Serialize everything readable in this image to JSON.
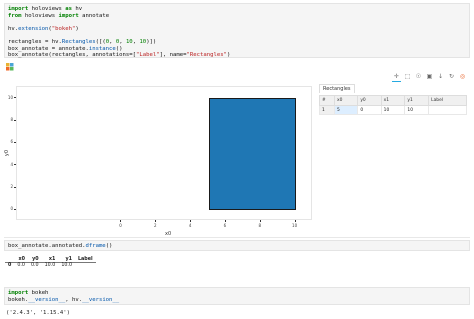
{
  "cell1": {
    "lines": [
      [
        [
          "kw",
          "import"
        ],
        [
          "plain",
          " holoviews "
        ],
        [
          "kw",
          "as"
        ],
        [
          "plain",
          " hv"
        ]
      ],
      [
        [
          "kw",
          "from"
        ],
        [
          "plain",
          " holoviews "
        ],
        [
          "kw",
          "import"
        ],
        [
          "plain",
          " annotate"
        ]
      ],
      [
        [
          "plain",
          ""
        ]
      ],
      [
        [
          "plain",
          "hv."
        ],
        [
          "fn",
          "extension"
        ],
        [
          "plain",
          "("
        ],
        [
          "str",
          "\"bokeh\""
        ],
        [
          "plain",
          ")"
        ]
      ],
      [
        [
          "plain",
          ""
        ]
      ],
      [
        [
          "plain",
          "rectangles = hv."
        ],
        [
          "fn",
          "Rectangles"
        ],
        [
          "plain",
          "([("
        ],
        [
          "num",
          "0"
        ],
        [
          "plain",
          ", "
        ],
        [
          "num",
          "0"
        ],
        [
          "plain",
          ", "
        ],
        [
          "num",
          "10"
        ],
        [
          "plain",
          ", "
        ],
        [
          "num",
          "10"
        ],
        [
          "plain",
          ")])"
        ]
      ],
      [
        [
          "plain",
          "box_annotate = annotate."
        ],
        [
          "fn",
          "instance"
        ],
        [
          "plain",
          "()"
        ]
      ],
      [
        [
          "plain",
          "box_annotate(rectangles, annotations=["
        ],
        [
          "str",
          "\"Label\""
        ],
        [
          "plain",
          "], name="
        ],
        [
          "str",
          "\"Rectangles\""
        ],
        [
          "plain",
          ")"
        ]
      ]
    ]
  },
  "plot": {
    "xlabel": "x0",
    "ylabel": "y0",
    "x_ticks": [
      "0",
      "2",
      "4",
      "6",
      "8",
      "10"
    ],
    "y_ticks": [
      "0",
      "2",
      "4",
      "6",
      "8",
      "10"
    ],
    "rect_color": "#1f77b4",
    "tools": [
      "pan-icon",
      "box-zoom-icon",
      "wheel-zoom-icon",
      "box-edit-icon",
      "save-icon",
      "reset-icon",
      "bokeh-logo-icon"
    ]
  },
  "chart_data": {
    "type": "rectangles",
    "xlabel": "x0",
    "ylabel": "y0",
    "xlim": [
      -6,
      11
    ],
    "ylim": [
      -1,
      11
    ],
    "rectangles": [
      {
        "x0": 5,
        "y0": 0,
        "x1": 10,
        "y1": 10
      }
    ]
  },
  "table": {
    "title": "Rectangles",
    "columns": [
      "#",
      "x0",
      "y0",
      "x1",
      "y1",
      "Label"
    ],
    "rows": [
      [
        "1",
        "5",
        "0",
        "10",
        "10",
        ""
      ]
    ]
  },
  "cell2": {
    "lines": [
      [
        [
          "plain",
          "box_annotate.annotated."
        ],
        [
          "fn",
          "dframe"
        ],
        [
          "plain",
          "()"
        ]
      ]
    ]
  },
  "dataframe": {
    "columns": [
      "",
      "x0",
      "y0",
      "x1",
      "y1",
      "Label"
    ],
    "rows": [
      [
        "0",
        "0.0",
        "0.0",
        "10.0",
        "10.0",
        ""
      ]
    ]
  },
  "cell3": {
    "lines": [
      [
        [
          "kw",
          "import"
        ],
        [
          "plain",
          " bokeh"
        ]
      ],
      [
        [
          "plain",
          "bokeh."
        ],
        [
          "fn",
          "__version__"
        ],
        [
          "plain",
          ", hv."
        ],
        [
          "fn",
          "__version__"
        ]
      ]
    ]
  },
  "version_output": "('2.4.3', '1.15.4')"
}
